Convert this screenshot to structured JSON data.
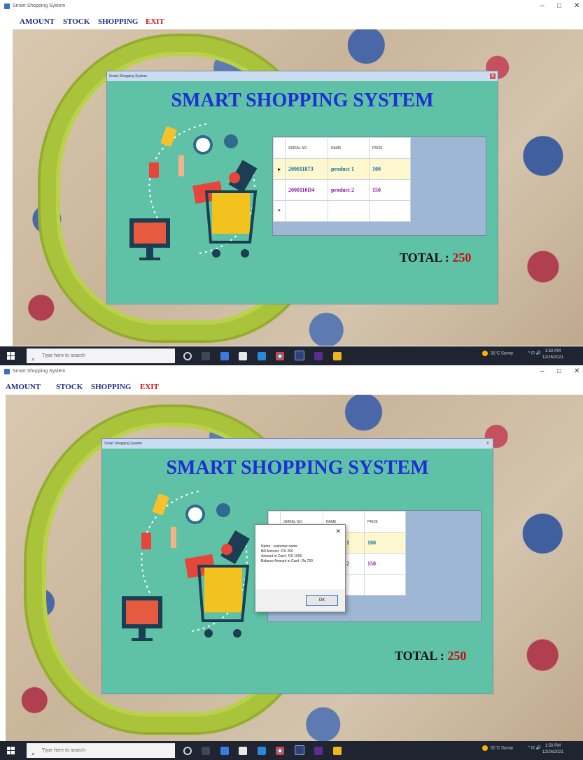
{
  "window": {
    "title": "Smart Shopping System",
    "min": "–",
    "max": "□",
    "close": "✕"
  },
  "menu": {
    "amount": "AMOUNT",
    "stock": "STOCK",
    "shopping": "SHOPPING",
    "exit": "EXIT"
  },
  "app": {
    "title": "Smart Shopping System",
    "heading": "SMART SHOPPING SYSTEM",
    "close": "x"
  },
  "grid": {
    "headers": [
      "SERIAL NO",
      "NAME",
      "PRIZE"
    ],
    "rows": [
      {
        "marker": "▸",
        "serial": "200011873",
        "name": "product 1",
        "prize": "100"
      },
      {
        "marker": "",
        "serial": "2000110D4",
        "name": "product 2",
        "prize": "150"
      },
      {
        "marker": "*",
        "serial": "",
        "name": "",
        "prize": ""
      }
    ]
  },
  "total": {
    "label": "TOTAL :",
    "value": "250"
  },
  "dialog": {
    "close": "✕",
    "lines": [
      "Name : customer name",
      "Bill Amount : RS 250",
      "Amount in Card : RS 1000",
      "Balance Amount in Card : Rs 750"
    ],
    "ok": "OK"
  },
  "taskbar": {
    "search_placeholder": "Type here to search",
    "weather": "31°C Sunny",
    "tray": "^ ⊡ 🔊",
    "time": "1:50 PM",
    "date": "12/26/2021"
  },
  "colors": {
    "app_bg": "#5fc2a6",
    "heading": "#1f2fd6",
    "total_value": "#c81010",
    "menu": "#1f2a8a",
    "exit": "#d01010"
  }
}
